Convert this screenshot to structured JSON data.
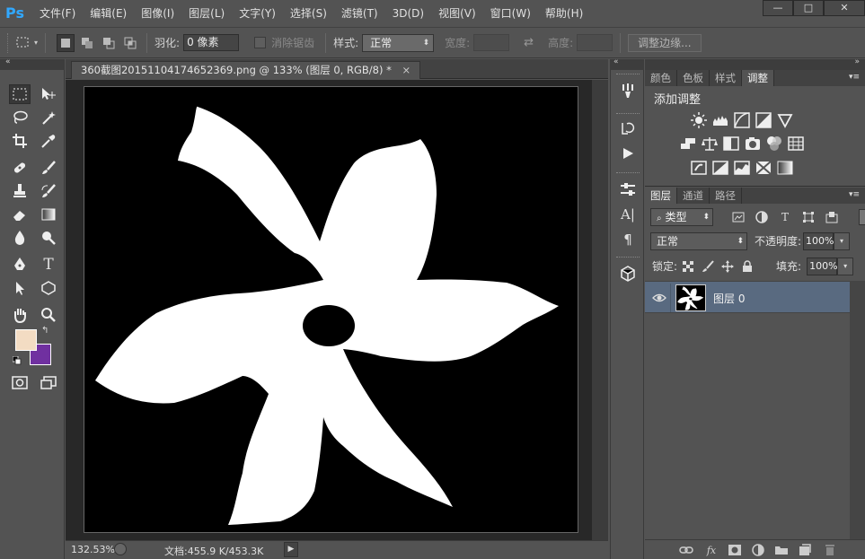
{
  "app": {
    "logo": "Ps"
  },
  "menu": [
    "文件(F)",
    "编辑(E)",
    "图像(I)",
    "图层(L)",
    "文字(Y)",
    "选择(S)",
    "滤镜(T)",
    "3D(D)",
    "视图(V)",
    "窗口(W)",
    "帮助(H)"
  ],
  "window_controls": {
    "minimize": "—",
    "maximize": "□",
    "close": "✕"
  },
  "options": {
    "feather_label": "羽化:",
    "feather_value": "0 像素",
    "antialias_label": "消除锯齿",
    "style_label": "样式:",
    "style_value": "正常",
    "width_label": "宽度:",
    "height_label": "高度:",
    "refine_edge": "调整边缘..."
  },
  "document": {
    "tab_title": "360截图20151104174652369.png @ 133% (图层 0, RGB/8) *",
    "tab_close": "×",
    "zoom": "132.53%",
    "doc_info": "文档:455.9 K/453.3K"
  },
  "colors": {
    "foreground": "#f3dcc3",
    "background": "#7030a0",
    "canvas_bg": "#000000",
    "flower": "#ffffff",
    "selected_layer": "#596a80"
  },
  "adjustments_panel": {
    "tabs": [
      "颜色",
      "色板",
      "样式",
      "调整"
    ],
    "active_tab": "调整",
    "title": "添加调整"
  },
  "layers_panel": {
    "tabs": [
      "图层",
      "通道",
      "路径"
    ],
    "active_tab": "图层",
    "filter_kind": "类型",
    "blend_mode": "正常",
    "opacity_label": "不透明度:",
    "opacity_value": "100%",
    "lock_label": "锁定:",
    "fill_label": "填充:",
    "fill_value": "100%",
    "layers": [
      {
        "name": "图层 0",
        "visible": true,
        "selected": true
      }
    ]
  },
  "icons": {
    "toolbox": [
      "marquee-icon",
      "move-icon",
      "lasso-icon",
      "magic-wand-icon",
      "crop-icon",
      "eyedropper-icon",
      "healing-brush-icon",
      "brush-icon",
      "clone-stamp-icon",
      "history-brush-icon",
      "eraser-icon",
      "gradient-icon",
      "blur-icon",
      "dodge-icon",
      "pen-icon",
      "type-icon",
      "path-select-icon",
      "shape-icon",
      "hand-icon",
      "zoom-icon",
      "quick-mask-icon",
      "screen-mode-icon"
    ],
    "mid_column": [
      "brush-preset-icon",
      "history-icon",
      "actions-icon",
      "tool-presets-icon",
      "character-icon",
      "paragraph-icon",
      "3d-icon"
    ]
  }
}
